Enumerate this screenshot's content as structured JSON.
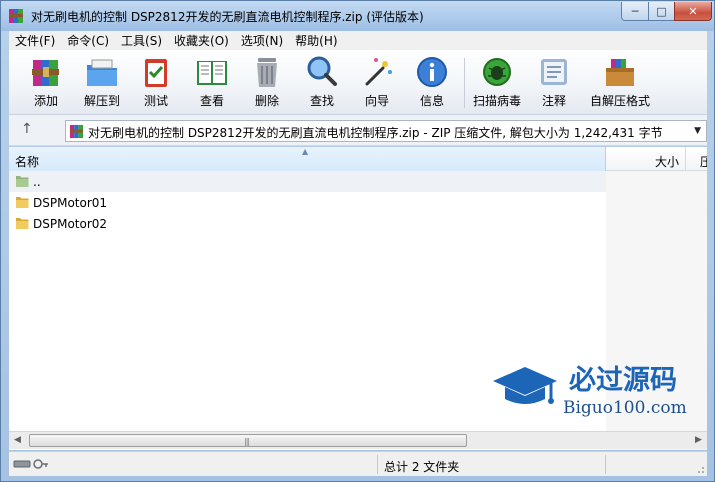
{
  "window": {
    "title": "对无刷电机的控制 DSP2812开发的无刷直流电机控制程序.zip (评估版本)",
    "buttons": {
      "minimize": "─",
      "maximize": "□",
      "close": "✕"
    }
  },
  "menu": [
    "文件(F)",
    "命令(C)",
    "工具(S)",
    "收藏夹(O)",
    "选项(N)",
    "帮助(H)"
  ],
  "toolbar": [
    {
      "label": "添加",
      "icon": "add-archive-icon"
    },
    {
      "label": "解压到",
      "icon": "extract-to-icon"
    },
    {
      "label": "测试",
      "icon": "test-icon"
    },
    {
      "label": "查看",
      "icon": "view-book-icon"
    },
    {
      "label": "删除",
      "icon": "trash-icon"
    },
    {
      "label": "查找",
      "icon": "magnifier-icon"
    },
    {
      "label": "向导",
      "icon": "wizard-wand-icon"
    },
    {
      "label": "信息",
      "icon": "info-icon"
    },
    {
      "label": "扫描病毒",
      "icon": "virus-scan-icon"
    },
    {
      "label": "注释",
      "icon": "comment-icon"
    },
    {
      "label": "自解压格式",
      "icon": "sfx-box-icon"
    }
  ],
  "address": {
    "up": "↑",
    "path": "对无刷电机的控制 DSP2812开发的无刷直流电机控制程序.zip - ZIP 压缩文件, 解包大小为 1,242,431 字节",
    "dropdown": "▼"
  },
  "columns": {
    "name": "名称",
    "size": "大小",
    "extra": "压"
  },
  "rows": [
    {
      "name": "..",
      "icon": "parent-folder-icon"
    },
    {
      "name": "DSPMotor01",
      "icon": "folder-icon"
    },
    {
      "name": "DSPMotor02",
      "icon": "folder-icon"
    }
  ],
  "watermark": {
    "title": "必过源码",
    "url": "Biguo100.com"
  },
  "scrollbar": {
    "left": "◀",
    "right": "▶",
    "grip": "|||"
  },
  "status": {
    "summary": "总计 2 文件夹"
  },
  "colors": {
    "accent": "#1d66b7",
    "title_bar": "#b6d0ee"
  }
}
